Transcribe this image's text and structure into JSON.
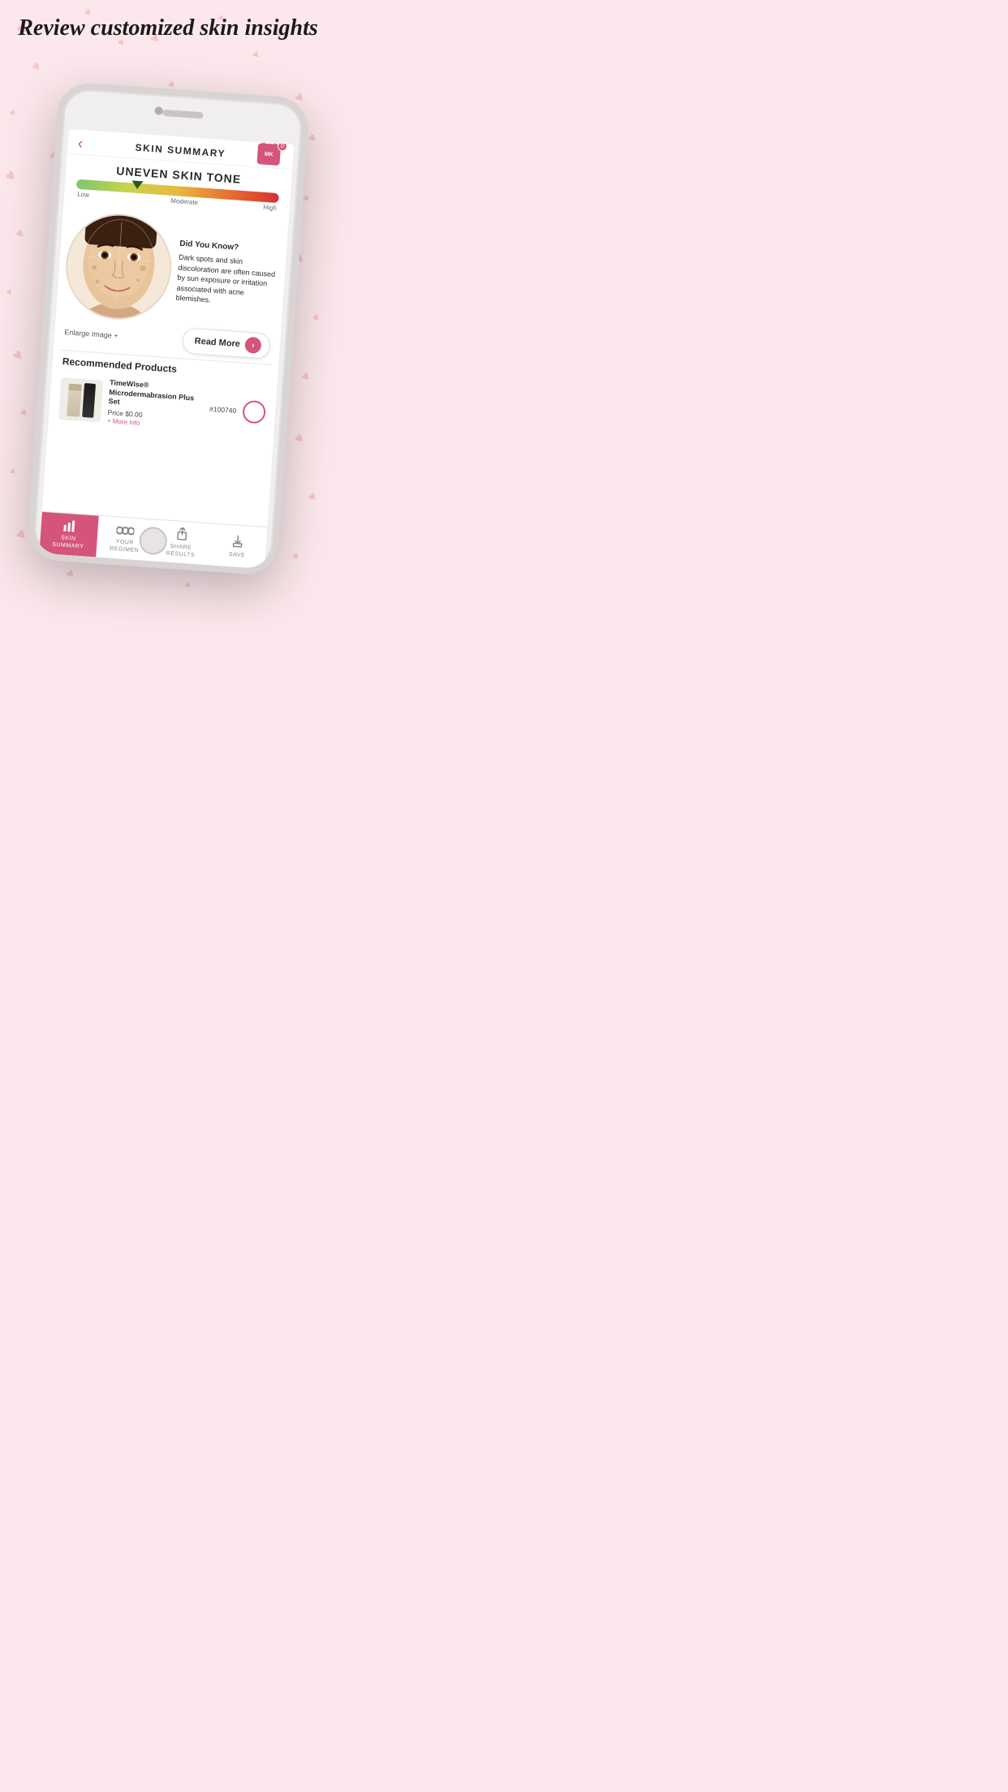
{
  "page": {
    "background_color": "#fce8ec",
    "heading": "Review customized skin insights"
  },
  "header": {
    "back_label": "‹",
    "title": "SKIN SUMMARY",
    "cart_letters": "MK",
    "cart_count": "0"
  },
  "concern": {
    "title": "UNEVEN SKIN TONE",
    "scale_low": "Low",
    "scale_moderate": "Moderate",
    "scale_high": "High",
    "marker_position": "30%"
  },
  "did_you_know": {
    "title": "Did You Know?",
    "body": "Dark spots and skin discoloration are often caused by sun exposure or irritation associated with acne blemishes."
  },
  "actions": {
    "enlarge": "Enlarge Image +",
    "read_more": "Read More"
  },
  "recommended": {
    "section_title": "Recommended Products",
    "products": [
      {
        "name": "TimeWise® Microdermabrasion Plus Set",
        "price": "Price $0.00",
        "sku": "#100740",
        "more_info": "+ More Info"
      }
    ]
  },
  "bottom_nav": [
    {
      "label": "SKIN\nSUMMARY",
      "icon": "bars",
      "active": true
    },
    {
      "label": "YOUR\nREGIMEN",
      "icon": "circles",
      "active": false
    },
    {
      "label": "SHARE\nRESULTS",
      "icon": "share",
      "active": false
    },
    {
      "label": "SAVE",
      "icon": "download",
      "active": false
    }
  ]
}
